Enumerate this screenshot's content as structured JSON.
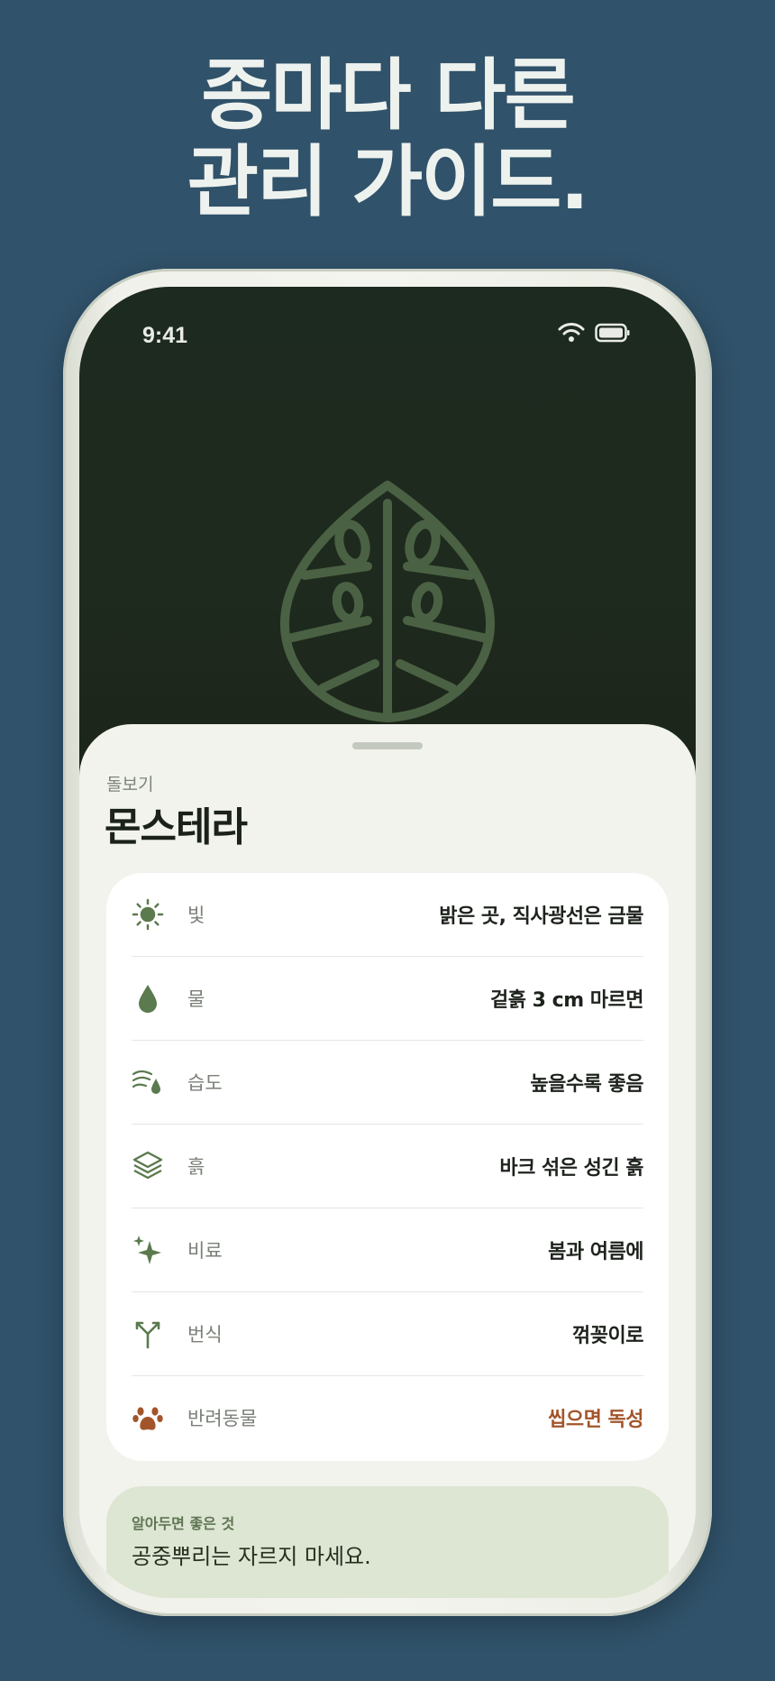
{
  "headline": {
    "line1": "종마다 다른",
    "line2": "관리 가이드."
  },
  "status_bar": {
    "time": "9:41"
  },
  "colors": {
    "background": "#30526a",
    "accent_green": "#5b7a4e",
    "warning": "#a2552a",
    "hero": "#1d2a1f"
  },
  "sheet": {
    "eyebrow": "돌보기",
    "title": "몬스테라"
  },
  "care": [
    {
      "icon": "sun-icon",
      "label": "빛",
      "value": "밝은 곳, 직사광선은 금물",
      "warning": false
    },
    {
      "icon": "water-drop-icon",
      "label": "물",
      "value": "겉흙 3 cm 마르면",
      "warning": false
    },
    {
      "icon": "humidity-icon",
      "label": "습도",
      "value": "높을수록 좋음",
      "warning": false
    },
    {
      "icon": "soil-layers-icon",
      "label": "흙",
      "value": "바크 섞은 성긴 흙",
      "warning": false
    },
    {
      "icon": "sparkle-icon",
      "label": "비료",
      "value": "봄과 여름에",
      "warning": false
    },
    {
      "icon": "propagation-icon",
      "label": "번식",
      "value": "꺾꽂이로",
      "warning": false
    },
    {
      "icon": "paw-icon",
      "label": "반려동물",
      "value": "씹으면 독성",
      "warning": true
    }
  ],
  "tip": {
    "label": "알아두면 좋은 것",
    "text": "공중뿌리는 자르지 마세요."
  }
}
